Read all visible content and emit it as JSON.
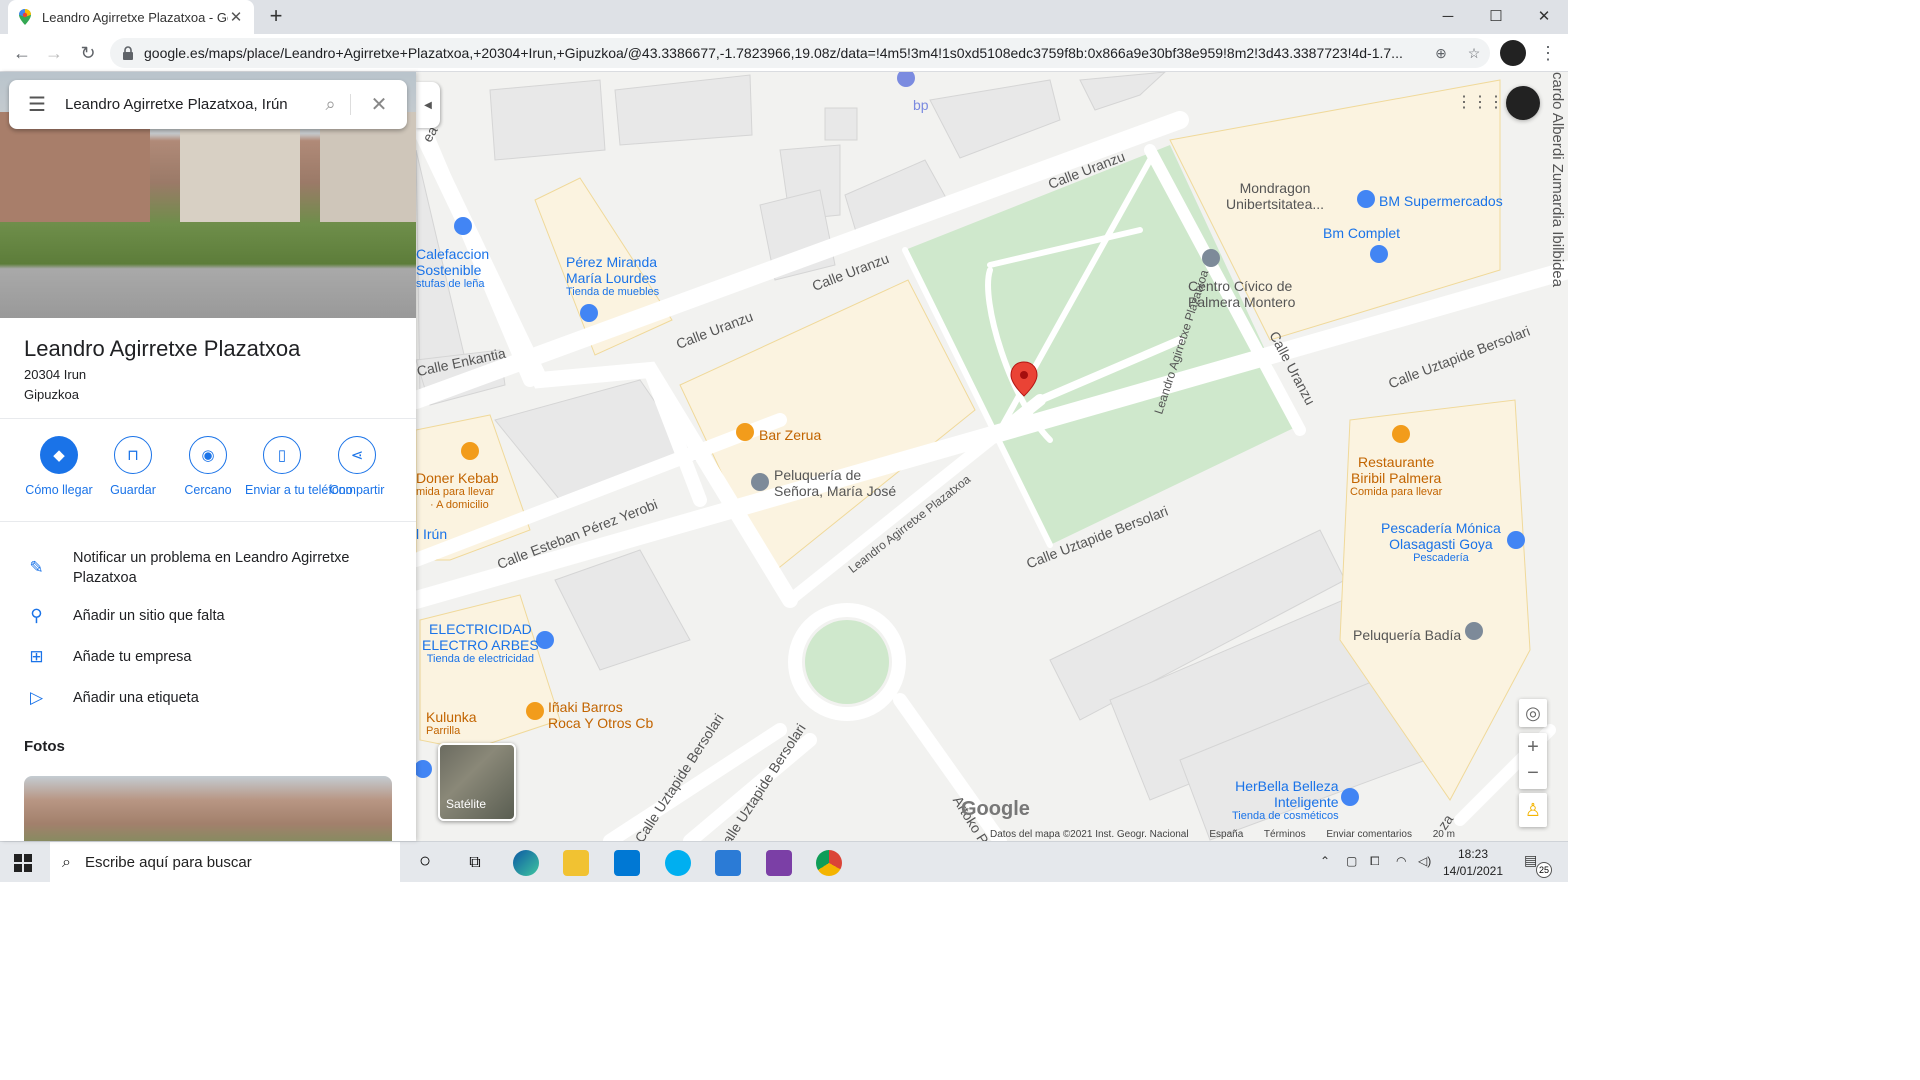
{
  "browser": {
    "tab_title": "Leandro Agirretxe Plazatxoa - Go",
    "url": "google.es/maps/place/Leandro+Agirretxe+Plazatxoa,+20304+Irun,+Gipuzkoa/@43.3386677,-1.7823966,19.08z/data=!4m5!3m4!1s0xd5108edc3759f8b:0x866a9e30bf38e959!8m2!3d43.3387723!4d-1.7..."
  },
  "sidebar": {
    "search_value": "Leandro Agirretxe Plazatxoa, Irún",
    "place_name": "Leandro Agirretxe Plazatxoa",
    "address_line1": "20304 Irun",
    "address_line2": "Gipuzkoa",
    "actions": [
      {
        "label": "Cómo llegar",
        "icon": "directions-icon"
      },
      {
        "label": "Guardar",
        "icon": "bookmark-icon"
      },
      {
        "label": "Cercano",
        "icon": "nearby-icon"
      },
      {
        "label": "Enviar a tu teléfono",
        "icon": "send-to-phone-icon"
      },
      {
        "label": "Compartir",
        "icon": "share-icon"
      }
    ],
    "links": [
      {
        "label": "Notificar un problema en Leandro Agirretxe Plazatxoa",
        "icon": "pencil-icon"
      },
      {
        "label": "Añadir un sitio que falta",
        "icon": "add-location-icon"
      },
      {
        "label": "Añade tu empresa",
        "icon": "add-business-icon"
      },
      {
        "label": "Añadir una etiqueta",
        "icon": "label-icon"
      }
    ],
    "photos_heading": "Fotos"
  },
  "map": {
    "pois": {
      "bp": "bp",
      "calefaccion1": "Calefaccion",
      "calefaccion2": "Sostenible",
      "calefaccion3": "stufas de leña",
      "perez1": "Pérez Miranda",
      "perez2": "María Lourdes",
      "perez3": "Tienda de muebles",
      "mondragon1": "Mondragon",
      "mondragon2": "Unibertsitatea...",
      "bm_super": "BM Supermercados",
      "bm_complet": "Bm Complet",
      "centro1": "Centro Cívico de",
      "centro2": "Palmera Montero",
      "bar_zerua": "Bar Zerua",
      "pelu1": "Peluquería de",
      "pelu2": "Señora, María José",
      "doner1": "Doner Kebab",
      "doner2": "mida para llevar",
      "doner3": "· A domicilio",
      "irun": "l Irún",
      "restaurante1": "Restaurante",
      "restaurante2": "Biribil Palmera",
      "restaurante3": "Comida para llevar",
      "pescaderia1": "Pescadería Mónica",
      "pescaderia2": "Olasagasti Goya",
      "pescaderia3": "Pescadería",
      "badia": "Peluquería Badía",
      "electro1": "ELECTRICIDAD",
      "electro2": "ELECTRO ARBES",
      "electro3": "Tienda de electricidad",
      "inaki1": "Iñaki Barros",
      "inaki2": "Roca Y Otros Cb",
      "kulunka1": "Kulunka",
      "kulunka2": "Parrilla",
      "herbella1": "HerBella Belleza",
      "herbella2": "Inteligente",
      "herbella3": "Tienda de cosméticos"
    },
    "streets": {
      "uranzu_top": "Calle Uranzu",
      "uranzu_mid": "Calle Uranzu",
      "uranzu_left": "Calle Uranzu",
      "uranzu_right": "Calle Uranzu",
      "enkantia": "Calle Enkantia",
      "esteban": "Calle Esteban Pérez Yerobi",
      "leandro_a": "Leandro Agirretxe Plazatxoa",
      "leandro_b": "Leandro Agirretxe Plazatxoa",
      "uztapide1": "Calle Uztapide Bersolari",
      "uztapide2": "Calle Uztapide Bersolari",
      "uztapide3": "Calle Uztapide Bersolari",
      "uztapide4": "Calle Uztapide Bersolari",
      "artoko": "Artoko P",
      "ricardo": "cardo Alberdi Zumardia Ibilbidea",
      "ea": "ea",
      "za": "za"
    },
    "google_logo": "Google",
    "satellite_label": "Satélite",
    "footer": {
      "data": "Datos del mapa ©2021 Inst. Geogr. Nacional",
      "country": "España",
      "terms": "Términos",
      "feedback": "Enviar comentarios",
      "scale": "20 m"
    }
  },
  "taskbar": {
    "search_placeholder": "Escribe aquí para buscar",
    "time": "18:23",
    "date": "14/01/2021",
    "notifications": "25"
  }
}
